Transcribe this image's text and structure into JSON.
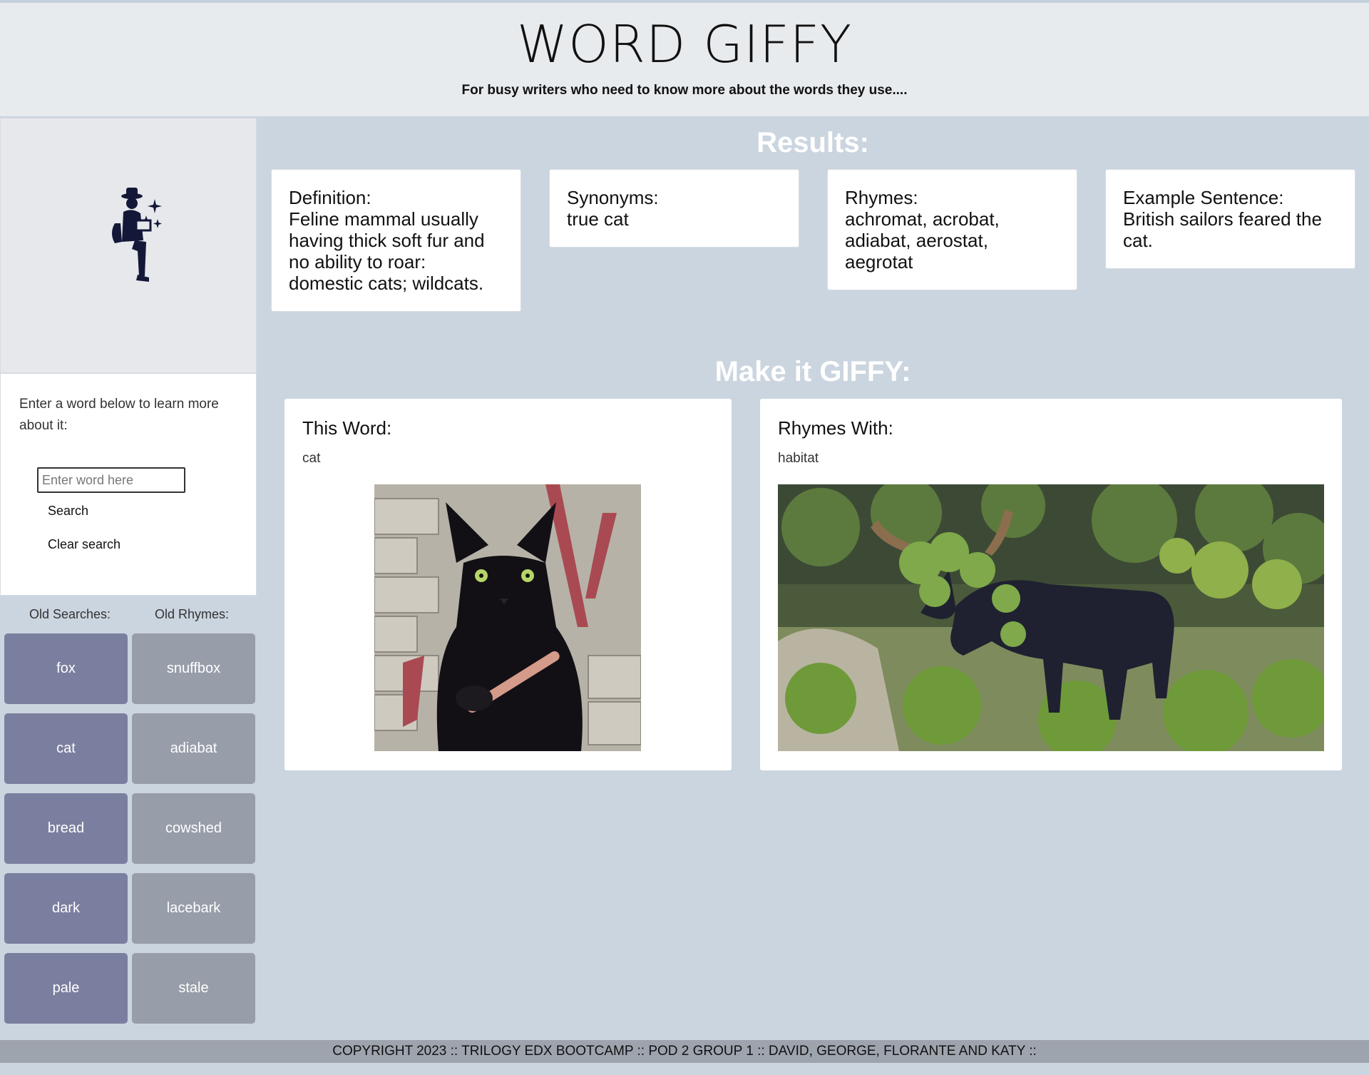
{
  "header": {
    "title": "WORD GIFFY",
    "tagline": "For busy writers who need to know more about the words they use...."
  },
  "sidebar": {
    "logo_icon": "moon-reader-logo",
    "prompt": "Enter a word below to learn more about it:",
    "input_placeholder": "Enter word here",
    "input_value": "",
    "search_label": "Search",
    "clear_label": "Clear search",
    "old_searches_label": "Old Searches:",
    "old_rhymes_label": "Old Rhymes:",
    "old_searches": [
      "fox",
      "cat",
      "bread",
      "dark",
      "pale"
    ],
    "old_rhymes": [
      "snuffbox",
      "adiabat",
      "cowshed",
      "lacebark",
      "stale"
    ]
  },
  "results": {
    "title": "Results:",
    "definition_label": "Definition:",
    "definition": "Feline mammal usually having thick soft fur and no ability to roar: domestic cats; wildcats.",
    "synonyms_label": "Synonyms:",
    "synonyms": "true cat",
    "rhymes_label": "Rhymes:",
    "rhymes": "achromat, acrobat, adiabat, aerostat, aegrotat",
    "example_label": "Example Sentence:",
    "example": "British sailors feared the cat."
  },
  "giffy": {
    "title": "Make it GIFFY:",
    "this_word_label": "This Word:",
    "this_word": "cat",
    "rhymes_with_label": "Rhymes With:",
    "rhymes_with": "habitat"
  },
  "footer": {
    "text": "COPYRIGHT 2023 :: TRILOGY EDX BOOTCAMP :: POD 2 GROUP 1 :: DAVID, GEORGE, FLORANTE AND KATY ::"
  },
  "colors": {
    "page_bg": "#cbd5df",
    "old_search_button": "#7b7f9f",
    "old_rhyme_button": "#979ea9",
    "logo_navy": "#141838"
  }
}
